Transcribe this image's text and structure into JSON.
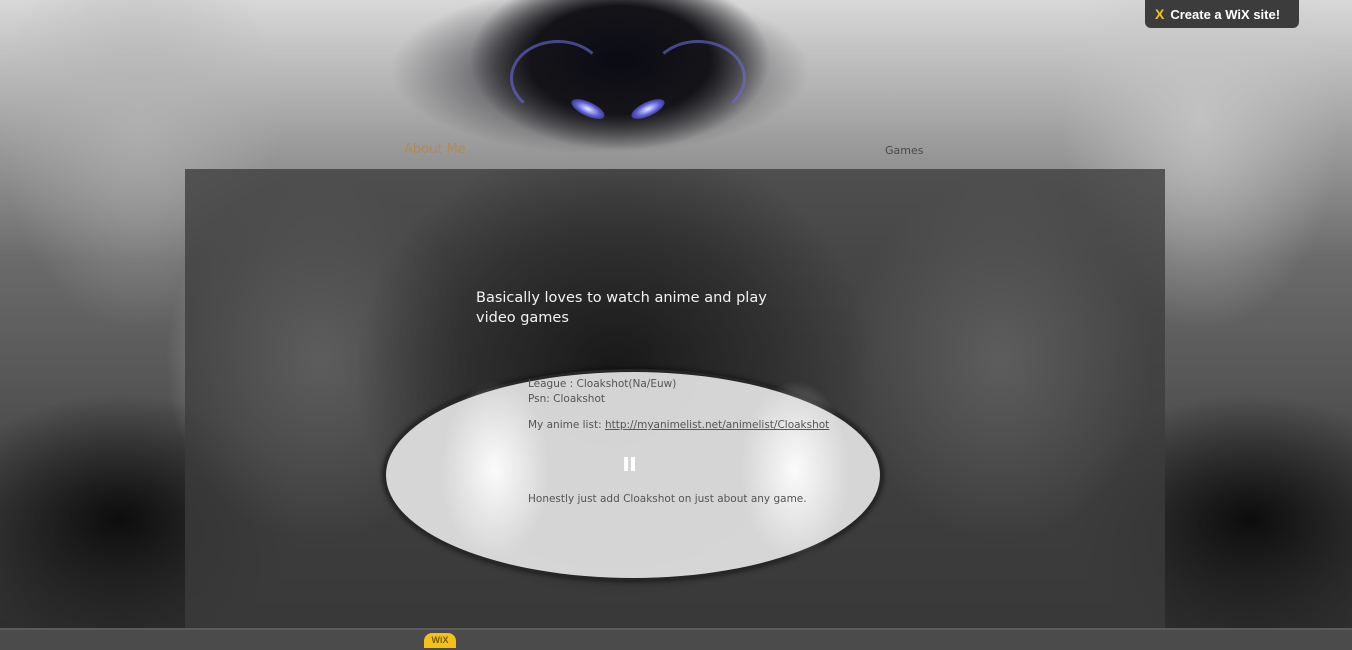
{
  "nav": {
    "about": "About Me",
    "games": "Games"
  },
  "tagline": "Basically loves to watch anime and play video games",
  "profile": {
    "league": "League : Cloakshot(Na/Euw)",
    "psn": "Psn: Cloakshot",
    "anime_prefix": "My anime list: ",
    "anime_link": "http://myanimelist.net/animelist/Cloakshot",
    "note": "Honestly just add Cloakshot on just about any game."
  },
  "wix": {
    "logo": "X",
    "label": "Create a WiX site!"
  },
  "bottom_logo": "WiX",
  "icons": {
    "player": "pause-icon",
    "wix": "wix-logo-icon"
  },
  "colors": {
    "nav_active": "#b08a56",
    "wix_accent": "#f5c518"
  }
}
